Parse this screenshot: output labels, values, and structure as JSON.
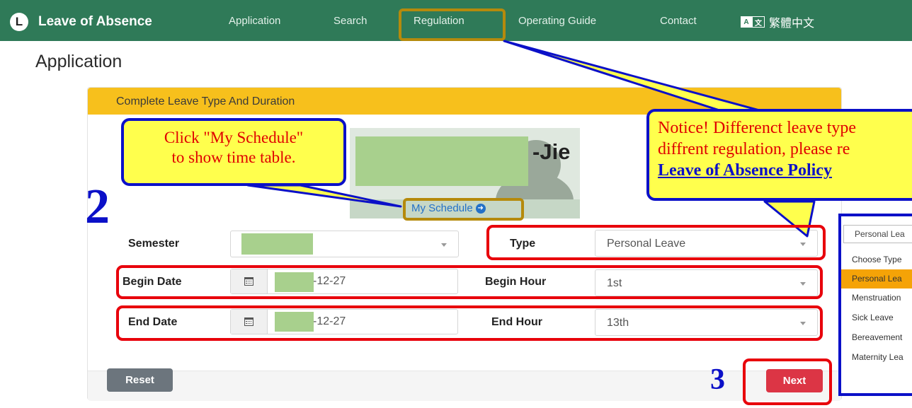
{
  "navbar": {
    "logo_letter": "L",
    "brand": "Leave of Absence",
    "links": [
      "Application",
      "Search",
      "Regulation",
      "Operating Guide",
      "Contact"
    ],
    "language_icon": "translate-icon",
    "language": "繁體中文",
    "background": "#2f7a58"
  },
  "page": {
    "title": "Application"
  },
  "card": {
    "header": "Complete Leave Type And Duration",
    "header_color": "#f7c01c"
  },
  "profile": {
    "name_fragment": "-Jie",
    "schedule_link": "My Schedule"
  },
  "form": {
    "semester": {
      "label": "Semester",
      "value": ""
    },
    "type": {
      "label": "Type",
      "value": "Personal Leave"
    },
    "begin_date": {
      "label": "Begin Date",
      "value": "-12-27"
    },
    "begin_hour": {
      "label": "Begin Hour",
      "value": "1st"
    },
    "end_date": {
      "label": "End Date",
      "value": "-12-27"
    },
    "end_hour": {
      "label": "End Hour",
      "value": "13th"
    }
  },
  "buttons": {
    "reset": "Reset",
    "next": "Next"
  },
  "dropdown": {
    "search_value": "Personal Lea",
    "options": [
      "Choose Type",
      "Personal Lea",
      "Menstruation",
      "Sick Leave",
      "Bereavement",
      "Maternity Lea"
    ],
    "selected_index": 1
  },
  "annotations": {
    "callout_schedule": [
      "Click \"My Schedule\"",
      "to show time table."
    ],
    "callout_notice": [
      "Notice! Differenct leave type",
      "diffrent regulation, please re"
    ],
    "callout_notice_link": "Leave of Absence Policy",
    "step_2": "2",
    "step_3": "3",
    "box_color_red": "#e8000b",
    "box_color_gold": "#b58a0c",
    "callout_border": "#0b10c8",
    "callout_fill": "#ffff4d"
  }
}
